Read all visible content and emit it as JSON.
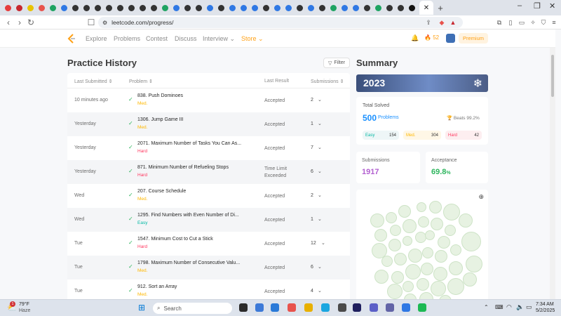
{
  "browser": {
    "url": "leetcode.com/progress/",
    "new_tab_label": "+",
    "favicon_colors": [
      "#e63c3c",
      "#c7272f",
      "#e8c300",
      "#e8534d",
      "#1ea362",
      "#2f78e4",
      "#333",
      "#333",
      "#333",
      "#333",
      "#333",
      "#333",
      "#333",
      "#333",
      "#1ea362",
      "#2f78e4",
      "#333",
      "#333",
      "#2f78e4",
      "#333",
      "#2f78e4",
      "#2f78e4",
      "#2f78e4",
      "#333",
      "#2f78e4",
      "#2f78e4",
      "#333",
      "#2f78e4",
      "#333",
      "#1ea362",
      "#2f78e4",
      "#2f78e4",
      "#333",
      "#1ea362",
      "#333",
      "#333",
      "#111"
    ],
    "window_controls": [
      "–",
      "❐",
      "✕"
    ]
  },
  "site_nav": {
    "links": [
      "Explore",
      "Problems",
      "Contest",
      "Discuss",
      "Interview",
      "Store"
    ],
    "streak": "52",
    "premium_label": "Premium",
    "store_color": "#ffa116"
  },
  "history": {
    "title": "Practice History",
    "filter_label": "Filter",
    "columns": [
      "Last Submitted",
      "Problem",
      "Last Result",
      "Submissions"
    ],
    "rows": [
      {
        "time": "10 minutes ago",
        "problem": "838. Push Dominoes",
        "difficulty": "Med.",
        "result": "Accepted",
        "submissions": "2"
      },
      {
        "time": "Yesterday",
        "problem": "1306. Jump Game III",
        "difficulty": "Med.",
        "result": "Accepted",
        "submissions": "1"
      },
      {
        "time": "Yesterday",
        "problem": "2071. Maximum Number of Tasks You Can As...",
        "difficulty": "Hard",
        "result": "Accepted",
        "submissions": "7"
      },
      {
        "time": "Yesterday",
        "problem": "871. Minimum Number of Refueling Stops",
        "difficulty": "Hard",
        "result": "Time Limit Exceeded",
        "submissions": "6"
      },
      {
        "time": "Wed",
        "problem": "207. Course Schedule",
        "difficulty": "Med.",
        "result": "Accepted",
        "submissions": "2"
      },
      {
        "time": "Wed",
        "problem": "1295. Find Numbers with Even Number of Di...",
        "difficulty": "Easy",
        "result": "Accepted",
        "submissions": "1"
      },
      {
        "time": "Tue",
        "problem": "1547. Minimum Cost to Cut a Stick",
        "difficulty": "Hard",
        "result": "Accepted",
        "submissions": "12"
      },
      {
        "time": "Tue",
        "problem": "1798. Maximum Number of Consecutive Valu...",
        "difficulty": "Med.",
        "result": "Accepted",
        "submissions": "6"
      },
      {
        "time": "Tue",
        "problem": "912. Sort an Array",
        "difficulty": "Med.",
        "result": "Accepted",
        "submissions": "4"
      }
    ],
    "difficulty_colors": {
      "Easy": "#00b8a3",
      "Med.": "#ffb800",
      "Hard": "#ff375f"
    }
  },
  "summary": {
    "title": "Summary",
    "year": "2023",
    "total_solved_label": "Total Solved",
    "total_solved": "500",
    "problems_label": "Problems",
    "beats": "Beats 99.2%",
    "easy_label": "Easy",
    "easy_count": "154",
    "med_label": "Med.",
    "med_count": "304",
    "hard_label": "Hard",
    "hard_count": "42",
    "submissions_label": "Submissions",
    "submissions": "1917",
    "acceptance_label": "Acceptance",
    "acceptance": "69.8",
    "acceptance_unit": "%"
  },
  "taskbar": {
    "weather_temp": "79°F",
    "weather_desc": "Haze",
    "weather_badge": "1",
    "search_placeholder": "Search",
    "time": "7:34 AM",
    "date": "5/2/2025"
  }
}
